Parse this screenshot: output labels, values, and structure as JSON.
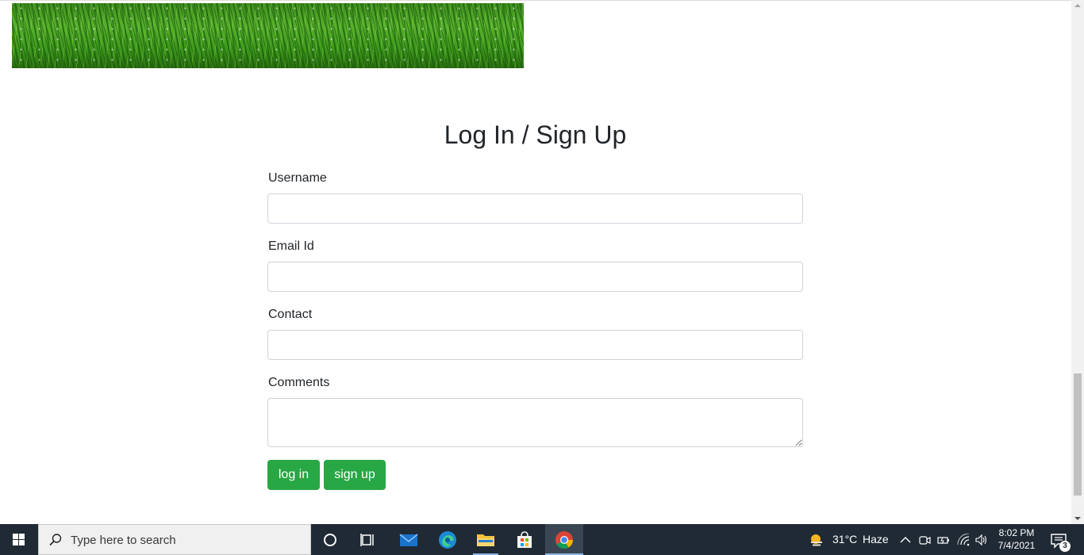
{
  "form": {
    "title": "Log In / Sign Up",
    "username_label": "Username",
    "username_value": "",
    "email_label": "Email Id",
    "email_value": "",
    "contact_label": "Contact",
    "contact_value": "",
    "comments_label": "Comments",
    "comments_value": "",
    "login_label": "log in",
    "signup_label": "sign up"
  },
  "taskbar": {
    "search_placeholder": "Type here to search",
    "weather_temp": "31°C",
    "weather_desc": "Haze",
    "time": "8:02 PM",
    "date": "7/4/2021",
    "notification_count": "3",
    "pinned": [
      "cortana-icon",
      "task-view-icon",
      "mail-icon",
      "edge-icon",
      "file-explorer-icon",
      "store-icon",
      "chrome-icon"
    ]
  },
  "colors": {
    "accent_green": "#28a745",
    "taskbar_bg": "#1f2a35"
  }
}
